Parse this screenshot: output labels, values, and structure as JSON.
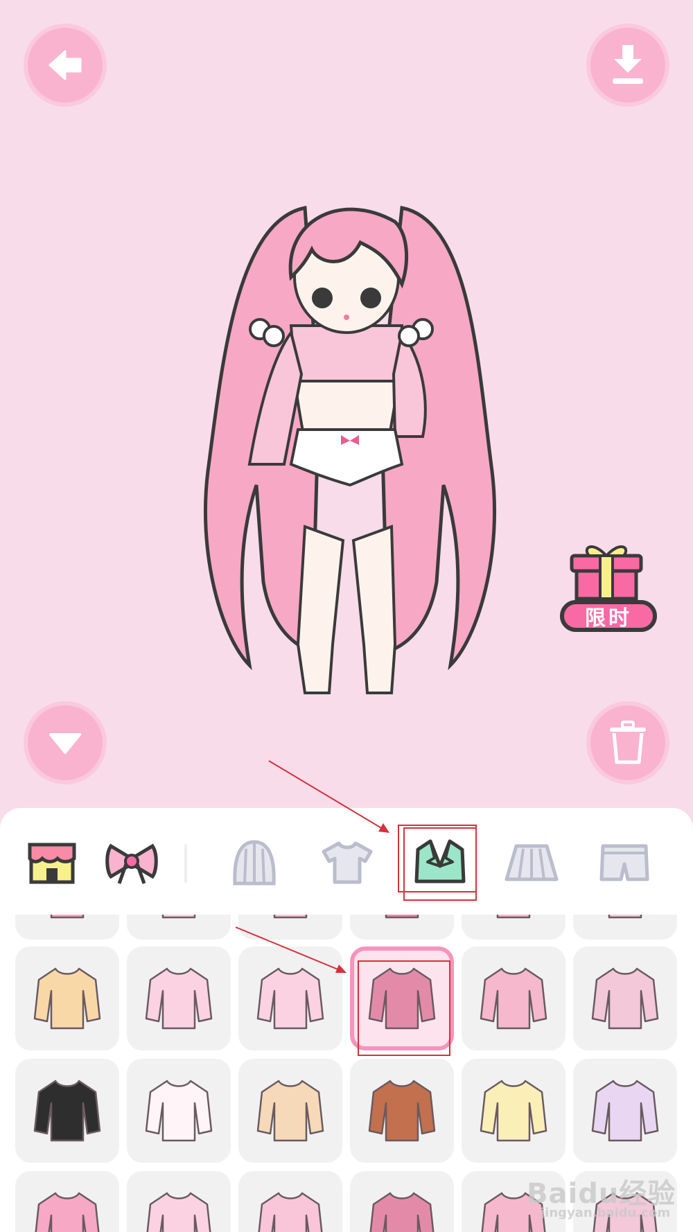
{
  "header": {
    "back_icon": "back-arrow-icon",
    "download_icon": "download-icon"
  },
  "stage": {
    "character": "dress-up-character",
    "gift_badge": {
      "label": "限时",
      "icon": "gift-box-icon"
    },
    "collapse_icon": "chevron-down-icon",
    "trash_icon": "trash-icon"
  },
  "categories": [
    {
      "name": "shop",
      "icon": "shop-icon"
    },
    {
      "name": "bow",
      "icon": "bow-icon"
    },
    {
      "name": "hair",
      "icon": "hair-icon"
    },
    {
      "name": "top",
      "icon": "t-shirt-icon"
    },
    {
      "name": "jacket",
      "icon": "jacket-icon",
      "selected": true
    },
    {
      "name": "skirt",
      "icon": "skirt-icon"
    },
    {
      "name": "shorts",
      "icon": "shorts-icon"
    }
  ],
  "items": [
    {
      "name": "item-partial-1"
    },
    {
      "name": "item-partial-2"
    },
    {
      "name": "item-partial-3"
    },
    {
      "name": "item-partial-4"
    },
    {
      "name": "item-partial-5"
    },
    {
      "name": "item-partial-6"
    },
    {
      "name": "cropped-top"
    },
    {
      "name": "pink-bow-blouse"
    },
    {
      "name": "photo-frame-card"
    },
    {
      "name": "pink-cropped-hoodie",
      "selected": true
    },
    {
      "name": "pink-shrug"
    },
    {
      "name": "pink-bomber-jacket"
    },
    {
      "name": "black-hoodie"
    },
    {
      "name": "white-coat"
    },
    {
      "name": "beige-cardigan"
    },
    {
      "name": "brown-robe"
    },
    {
      "name": "yellow-jacket"
    },
    {
      "name": "striped-sweater"
    },
    {
      "name": "item-row4-1"
    },
    {
      "name": "item-row4-2"
    },
    {
      "name": "item-row4-3"
    },
    {
      "name": "item-row4-4"
    },
    {
      "name": "item-row4-5"
    },
    {
      "name": "item-row4-6"
    }
  ],
  "watermark": {
    "brand": "Baidu经验",
    "url": "jingyan.baidu.com"
  },
  "colors": {
    "stage_bg": "#f8dcea",
    "button_pink": "#f9b3cf",
    "selected_border": "#f694bd",
    "annotation_red": "#d5313c"
  }
}
